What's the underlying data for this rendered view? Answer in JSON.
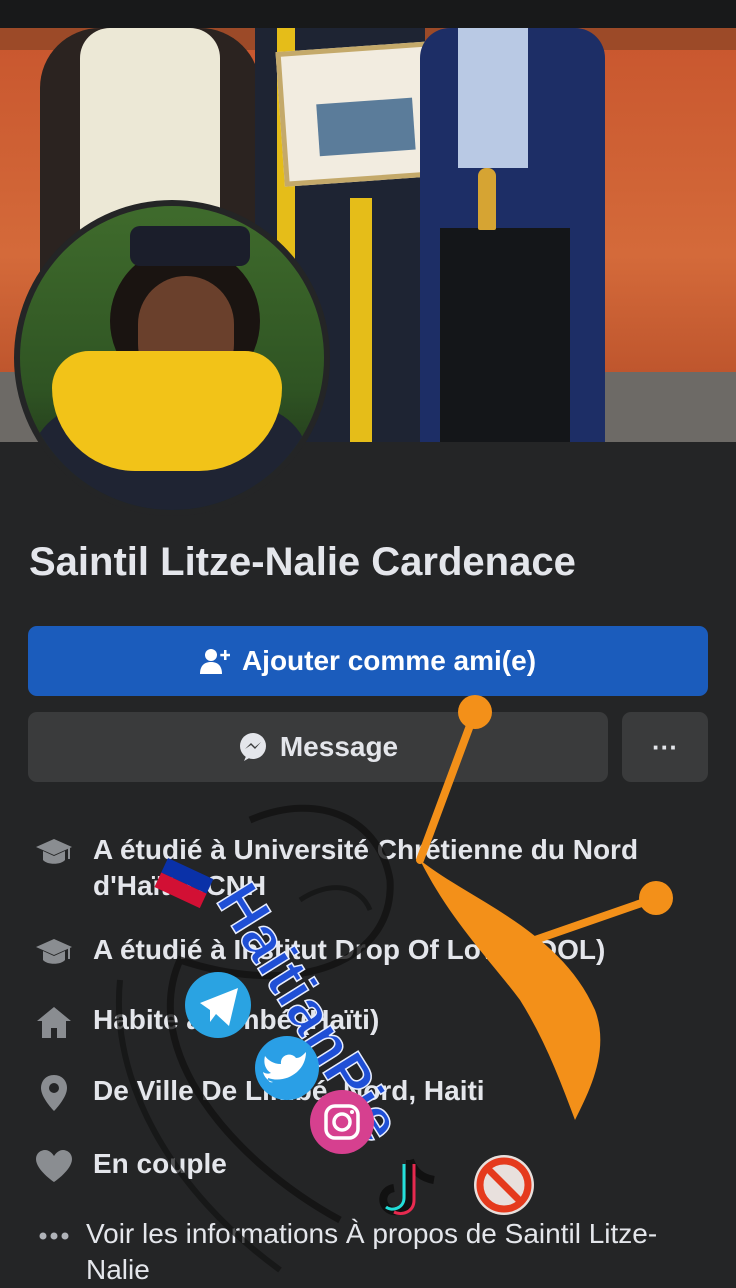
{
  "profile": {
    "name": "Saintil Litze-Nalie Cardenace"
  },
  "actions": {
    "add_friend_label": "Ajouter comme ami(e)",
    "message_label": "Message",
    "more_label": "···"
  },
  "details": [
    {
      "icon": "graduation-cap-icon",
      "text": "A étudié à Université Chrétienne du Nord d'Haïti UCNH"
    },
    {
      "icon": "graduation-cap-icon",
      "text": "A étudié à Institut Drop Of Love (IDOL)"
    },
    {
      "icon": "home-icon",
      "text": "Habite à Limbé (Haïti)"
    },
    {
      "icon": "location-pin-icon",
      "text": "De Ville De Limbé, Nord, Haiti"
    },
    {
      "icon": "heart-icon",
      "text": "En couple"
    },
    {
      "icon": "more-dots-icon",
      "text": "Voir les informations À propos de Saintil Litze-Nalie"
    }
  ],
  "watermark": {
    "text": "HaitianPie"
  },
  "colors": {
    "background": "#242526",
    "primary_button": "#1b5cbc",
    "secondary_button": "#3a3b3c",
    "text": "#e4e6eb",
    "watermark_blue": "#1f4fd6",
    "watermark_orange": "#f39019"
  }
}
